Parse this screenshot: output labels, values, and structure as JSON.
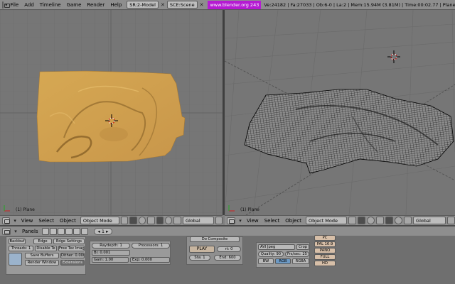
{
  "topbar": {
    "menus": [
      "File",
      "Add",
      "Timeline",
      "Game",
      "Render",
      "Help"
    ],
    "screen": "SR:2-Model",
    "scene": "SCE:Scene",
    "url": "www.blender.org 243",
    "stats": "Ve:24182 | Fa:27033 | Ob:6-0 | La:2 | Mem:15.94M (3.81M) | Time:00:02.77 | Plane"
  },
  "viewports": {
    "left_label": "(1) Plane",
    "right_label": "(1) Plane"
  },
  "view_headers": {
    "menus": [
      "View",
      "Select",
      "Object"
    ],
    "mode": "Object Mode",
    "orientation": "Global"
  },
  "buttons_window": {
    "panels_label": "Panels",
    "frame": "1",
    "render": {
      "backbuf": "Backbuf",
      "edge": "Edge",
      "edge_settings": "Edge Settings",
      "threads": "Threads: 1",
      "disable_tex": "Disable Te",
      "free_tex": "Free Tex Image",
      "save_buffers": "Save Buffers",
      "dither": "Dither: 0.000",
      "render_window": "Render Window",
      "extensions": "Extensions",
      "raydepth": "Raydepth: 1",
      "processors": "Processors: 1",
      "bi": "Bi: 0.001",
      "gam": "Gam: 1.00",
      "exp": "Exp: 0.000"
    },
    "anim": {
      "do_composite": "Do Composite",
      "play": "PLAY",
      "rt": "rt: 0",
      "sta": "Sta: 1",
      "end": "End: 600"
    },
    "format": {
      "codec": "AVI Jpeg",
      "crop": "Crop",
      "quality": "Quality: 90",
      "frs_sec": "Frs/sec: 25",
      "bw": "BW",
      "rgb": "RGB",
      "rgba": "RGBA"
    },
    "presets": [
      "PC",
      "PAL 16:9",
      "PANO",
      "FULL",
      "HD"
    ]
  },
  "colors": {
    "terrain": "#d2a24f",
    "viewport_bg": "#767676",
    "url_bg": "#b51bd2"
  }
}
